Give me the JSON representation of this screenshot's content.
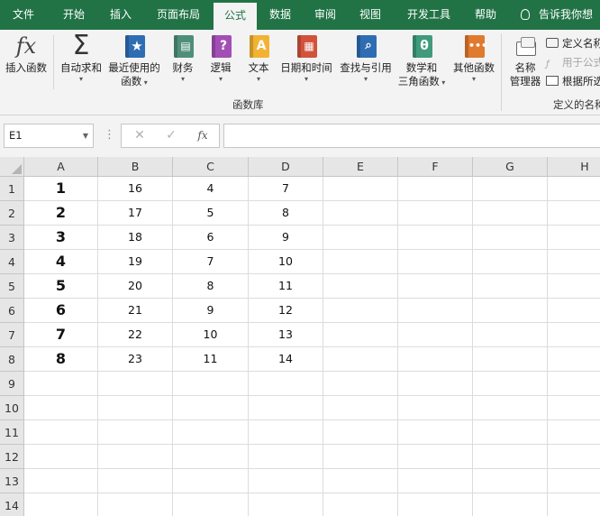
{
  "tabs": [
    {
      "label": "文件",
      "active": false
    },
    {
      "label": "开始",
      "active": false
    },
    {
      "label": "插入",
      "active": false
    },
    {
      "label": "页面布局",
      "active": false
    },
    {
      "label": "公式",
      "active": true
    },
    {
      "label": "数据",
      "active": false
    },
    {
      "label": "审阅",
      "active": false
    },
    {
      "label": "视图",
      "active": false
    },
    {
      "label": "开发工具",
      "active": false
    },
    {
      "label": "帮助",
      "active": false
    }
  ],
  "tell_me": "告诉我你想",
  "ribbon": {
    "insert_function": "插入函数",
    "autosum": "自动求和",
    "recent_line1": "最近使用的",
    "recent_line2": "函数",
    "financial": "财务",
    "logical": "逻辑",
    "text": "文本",
    "datetime": "日期和时间",
    "lookup": "查找与引用",
    "math_line1": "数学和",
    "math_line2": "三角函数",
    "more": "其他函数",
    "library_label": "函数库",
    "name_mgr_line1": "名称",
    "name_mgr_line2": "管理器",
    "define_name": "定义名称",
    "use_in_formula": "用于公式",
    "create_from_sel": "根据所选",
    "defined_names_label": "定义的名称"
  },
  "formula_bar": {
    "name_box": "E1",
    "dots": "⋮",
    "cancel": "✕",
    "enter": "✓",
    "fx": "fx",
    "content": ""
  },
  "sheet": {
    "columns": [
      "A",
      "B",
      "C",
      "D",
      "E",
      "F",
      "G",
      "H"
    ],
    "rows": [
      "1",
      "2",
      "3",
      "4",
      "5",
      "6",
      "7",
      "8",
      "9",
      "10",
      "11",
      "12",
      "13",
      "14"
    ],
    "data": {
      "A": [
        "1",
        "2",
        "3",
        "4",
        "5",
        "6",
        "7",
        "8"
      ],
      "B": [
        "16",
        "17",
        "18",
        "19",
        "20",
        "21",
        "22",
        "23"
      ],
      "C": [
        "4",
        "5",
        "6",
        "7",
        "8",
        "9",
        "10",
        "11"
      ],
      "D": [
        "7",
        "8",
        "9",
        "10",
        "11",
        "12",
        "13",
        "14"
      ]
    }
  },
  "colors": {
    "brand": "#217346",
    "book_financial": "#4f8f7a",
    "book_logical": "#a24fb5",
    "book_text": "#f2b233",
    "book_datetime": "#d2533c",
    "book_lookup": "#2f6db3",
    "book_math": "#3f9b7c",
    "book_more": "#e07a2e",
    "book_recent": "#2f6db3"
  }
}
